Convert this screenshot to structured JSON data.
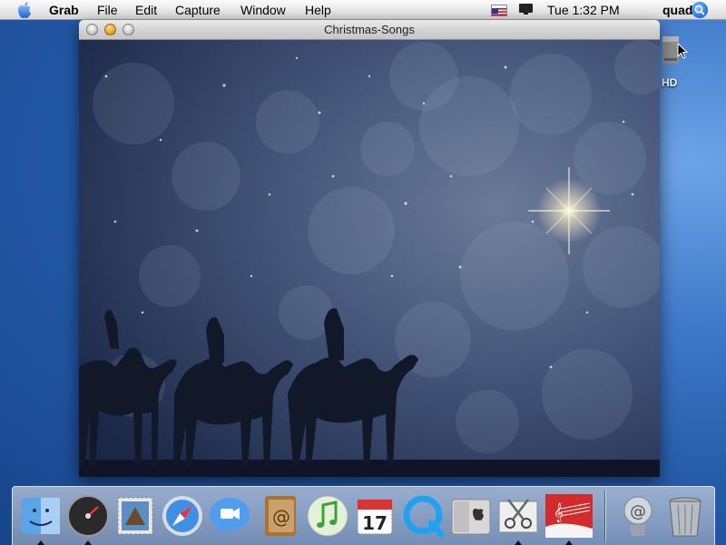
{
  "menubar": {
    "app_name": "Grab",
    "menus": [
      "File",
      "Edit",
      "Capture",
      "Window",
      "Help"
    ],
    "clock": "Tue 1:32 PM",
    "user": "quad8"
  },
  "desktop": {
    "hd_label": "HD"
  },
  "window": {
    "title": "Christmas-Songs",
    "image_subject": "three-wise-men-camel-silhouettes-under-star"
  },
  "dock": {
    "apps": [
      "Finder",
      "Dashboard",
      "Mail",
      "Safari",
      "iChat",
      "Address Book",
      "iTunes",
      "iCal",
      "QuickTime Player",
      "System Preferences",
      "Grab",
      "Christmas-Songs"
    ],
    "others": [
      "Downloads",
      "Trash"
    ]
  },
  "colors": {
    "desktop_blue": "#245aa8",
    "night_sky": "#2f3d5f"
  }
}
